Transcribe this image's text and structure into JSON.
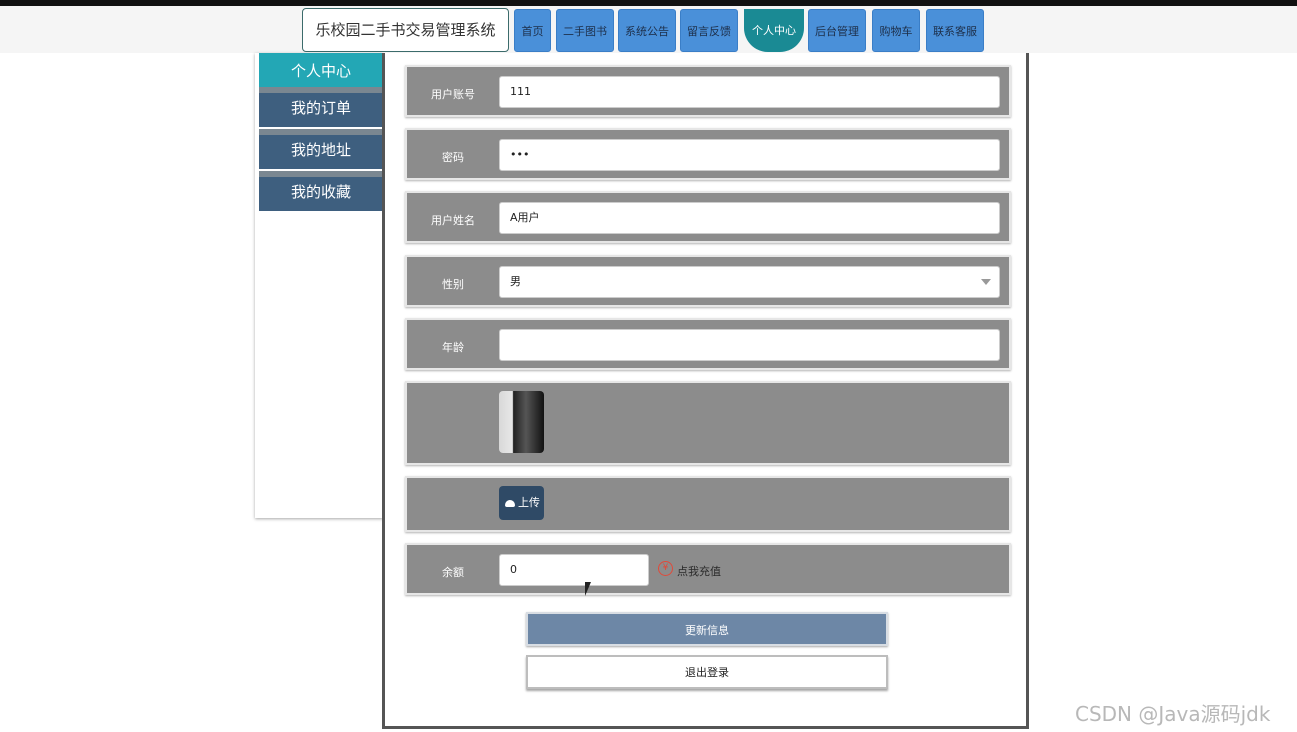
{
  "header": {
    "brand": "乐校园二手书交易管理系统",
    "nav": [
      {
        "label": "首页"
      },
      {
        "label": "二手图书"
      },
      {
        "label": "系统公告"
      },
      {
        "label": "留言反馈"
      },
      {
        "label": "个人中心",
        "active": true
      },
      {
        "label": "后台管理"
      },
      {
        "label": "购物车"
      },
      {
        "label": "联系客服"
      }
    ]
  },
  "sidebar": {
    "items": [
      {
        "label": "个人中心",
        "active": true
      },
      {
        "label": "我的订单"
      },
      {
        "label": "我的地址"
      },
      {
        "label": "我的收藏"
      }
    ]
  },
  "form": {
    "account": {
      "label": "用户账号",
      "value": "111"
    },
    "password": {
      "label": "密码",
      "value": "•••"
    },
    "name": {
      "label": "用户姓名",
      "value": "A用户"
    },
    "gender": {
      "label": "性别",
      "value": "男"
    },
    "age": {
      "label": "年龄",
      "value": ""
    },
    "upload": {
      "label": "上传"
    },
    "balance": {
      "label": "余额",
      "value": "0",
      "recharge_icon": "¥",
      "recharge_text": "点我充值"
    }
  },
  "actions": {
    "update": "更新信息",
    "logout": "退出登录"
  },
  "watermark": "CSDN @Java源码jdk",
  "colors": {
    "nav_button": "#4a90d9",
    "nav_active": "#1a8a94",
    "sidebar_active": "#23a7b5",
    "sidebar_item": "#3e5f7f",
    "row_bg": "#8c8c8c",
    "update_button": "#6d87a6"
  }
}
